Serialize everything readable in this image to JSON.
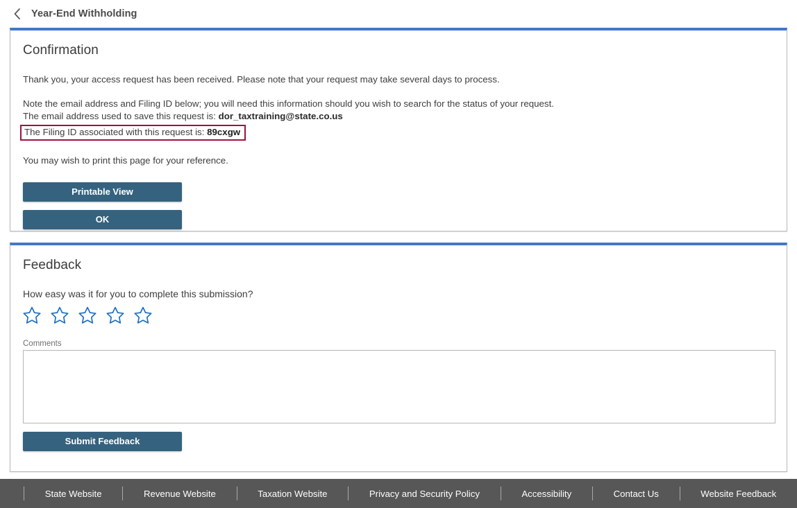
{
  "header": {
    "back_icon": "chevron-left-icon",
    "title": "Year-End Withholding"
  },
  "confirmation": {
    "heading": "Confirmation",
    "thank_you": "Thank you, your access request has been received. Please note that your request may take several days to process.",
    "note_line": "Note the email address and Filing ID below; you will need this information should you wish to search for the status of your request.",
    "email_label": "The email address used to save this request is:",
    "email_value": "dor_taxtraining@state.co.us",
    "filing_id_label": "The Filing ID associated with this request is:",
    "filing_id_value": "89cxgw",
    "print_note": "You may wish to print this page for your reference.",
    "printable_view_label": "Printable View",
    "ok_label": "OK",
    "highlight_color": "#a30f3c"
  },
  "feedback": {
    "heading": "Feedback",
    "question": "How easy was it for you to complete this submission?",
    "rating": {
      "max": 5,
      "selected": 0,
      "star_color": "#1f6fc4"
    },
    "comments_label": "Comments",
    "comments_value": "",
    "comments_placeholder": "",
    "submit_label": "Submit Feedback"
  },
  "theme": {
    "card_top_border": "#4178c8",
    "button_color": "#35627f",
    "footer_color": "#575757"
  },
  "footer": {
    "links": [
      {
        "label": "State Website"
      },
      {
        "label": "Revenue Website"
      },
      {
        "label": "Taxation Website"
      },
      {
        "label": "Privacy and Security Policy"
      },
      {
        "label": "Accessibility"
      },
      {
        "label": "Contact Us"
      },
      {
        "label": "Website Feedback"
      }
    ]
  }
}
